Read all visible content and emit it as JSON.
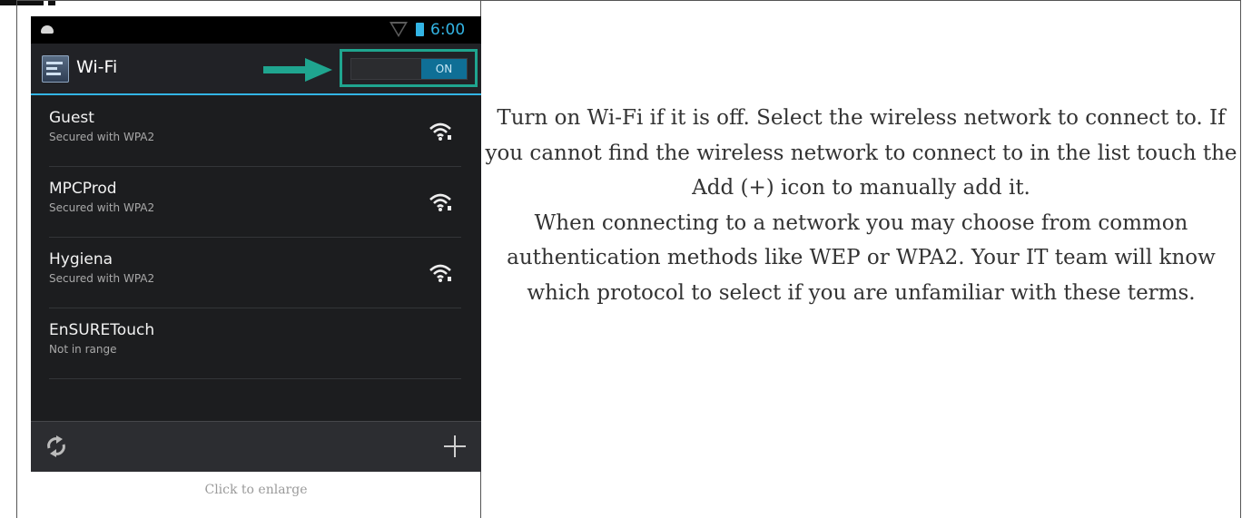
{
  "phone": {
    "status_time": "6:00",
    "title": "Wi-Fi",
    "toggle_label": "ON",
    "accent_color": "#33b5e5",
    "highlight_color": "#1fa58f",
    "networks": [
      {
        "name": "Guest",
        "security": "Secured with WPA2",
        "icon": "wifi-signal-icon"
      },
      {
        "name": "MPCProd",
        "security": "Secured with WPA2",
        "icon": "wifi-signal-icon"
      },
      {
        "name": "Hygiena",
        "security": "Secured with WPA2",
        "icon": "wifi-signal-icon"
      },
      {
        "name": "EnSURETouch",
        "security": "Not in range",
        "icon": null
      }
    ],
    "bottom_icons": [
      "wps-refresh-icon",
      "add-icon"
    ]
  },
  "caption": "Click to enlarge",
  "description": {
    "paragraph_1": "Turn on Wi-Fi if it is off. Select the wireless network to connect to. If you cannot find the wireless network to connect to in the list touch the Add (+) icon to manually add it.",
    "paragraph_2": "When connecting to a network you may choose from common authentication methods like WEP or WPA2. Your IT team will know which protocol to select if you are unfamiliar with these terms."
  }
}
